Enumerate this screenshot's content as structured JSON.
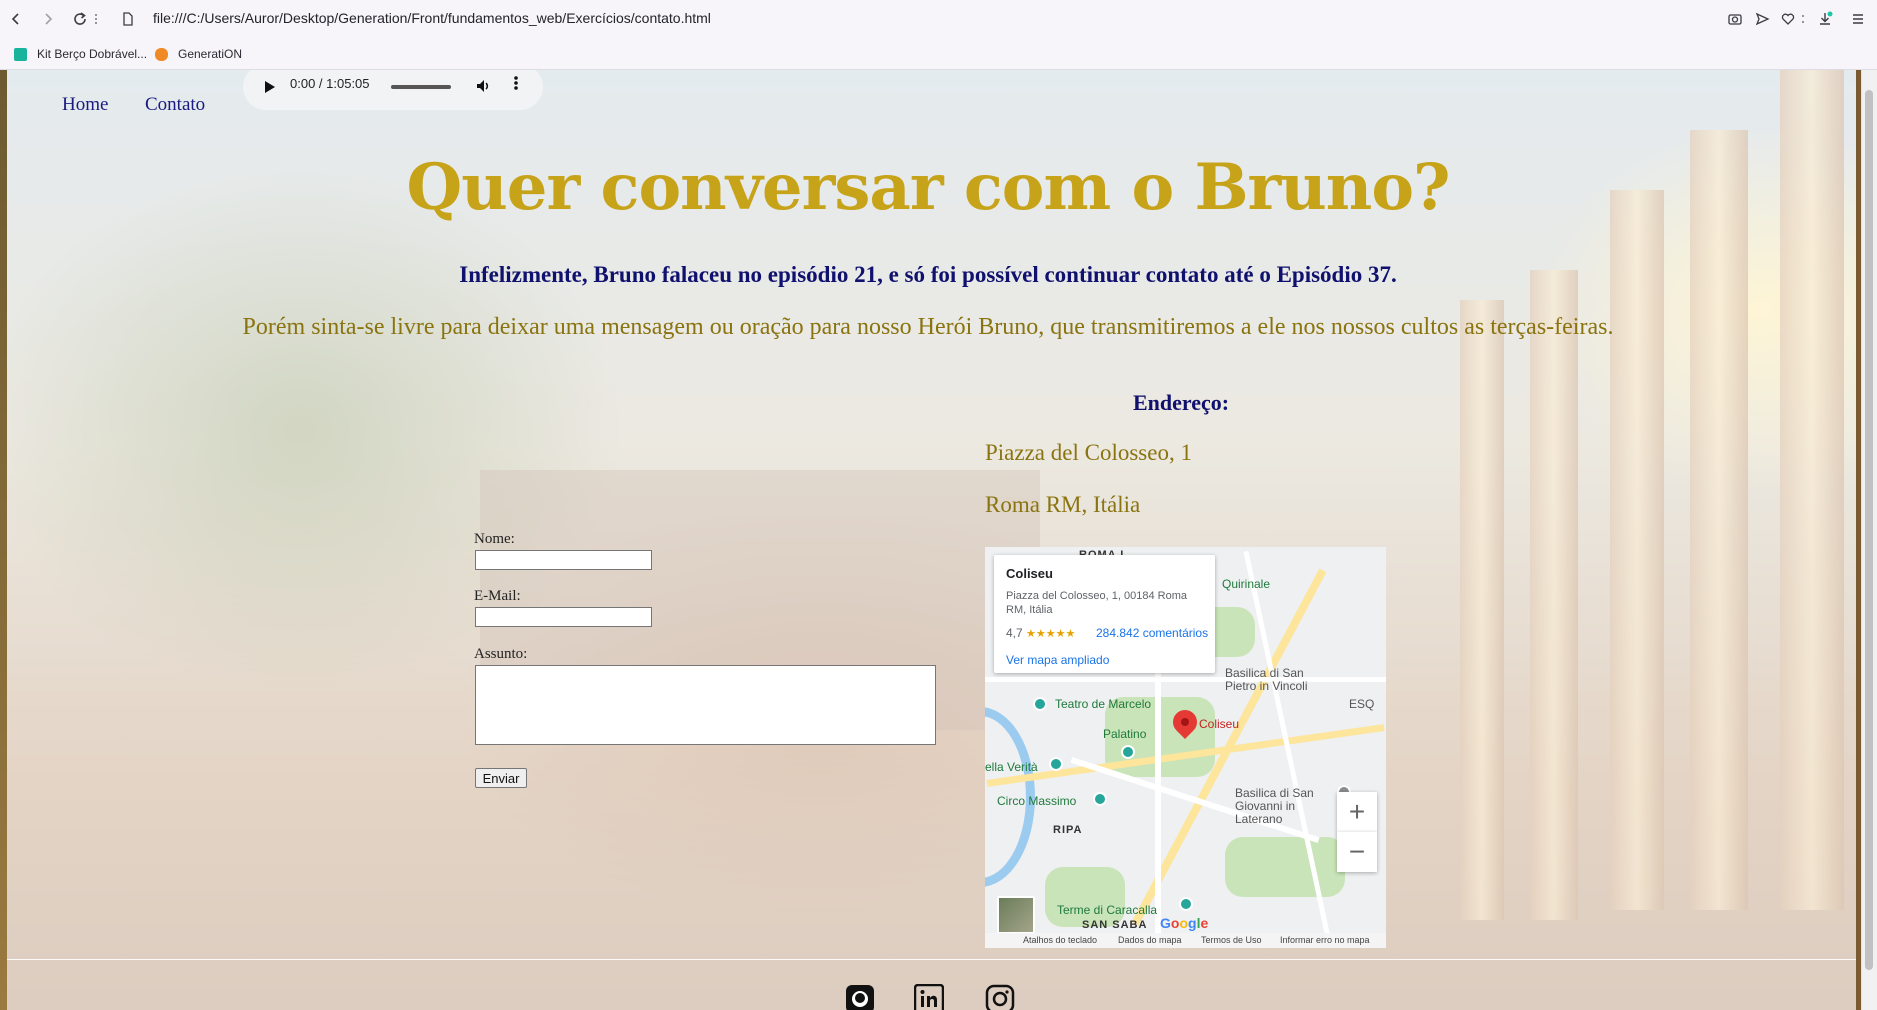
{
  "browser": {
    "url": "file:///C:/Users/Auror/Desktop/Generation/Front/fundamentos_web/Exercícios/contato.html",
    "bookmarks": [
      {
        "label": "Kit Berço Dobrável...",
        "color": "#18b39b"
      },
      {
        "label": "GeneratiON",
        "color": "#f08a24"
      }
    ]
  },
  "nav": {
    "home": "Home",
    "contact": "Contato"
  },
  "audio": {
    "time": "0:00 / 1:05:05"
  },
  "main": {
    "title": "Quer conversar com o Bruno?",
    "lead": "Infelizmente, Bruno falaceu no episódio 21, e só foi possível continuar contato até o Episódio 37.",
    "invite": "Porém sinta-se livre para deixar uma mensagem ou oração para nosso Herói Bruno, que transmitiremos a ele nos nossos cultos as terças-feiras."
  },
  "form": {
    "name_label": "Nome:",
    "email_label": "E-Mail:",
    "subject_label": "Assunto:",
    "submit_label": "Enviar"
  },
  "address": {
    "title": "Endereço:",
    "line1": "Piazza del Colosseo, 1",
    "line2": "Roma RM, Itália"
  },
  "map": {
    "card": {
      "title": "Coliseu",
      "address": "Piazza del Colosseo, 1, 00184 Roma RM, Itália",
      "rating": "4,7",
      "stars": "★★★★★",
      "reviews": "284.842 comentários",
      "link": "Ver mapa ampliado"
    },
    "labels": {
      "roma": "ROMA I",
      "quirinale": "Quirinale",
      "basilica_vincoli": "Basilica di San Pietro in Vincoli",
      "teatro": "Teatro de Marcelo",
      "palatino": "Palatino",
      "coliseu": "Coliseu",
      "verita": "ella Verità",
      "circo": "Circo Massimo",
      "basilica_laterano": "Basilica di San Giovanni in Laterano",
      "ripa": "RIPA",
      "terme": "Terme di Caracalla",
      "san_saba": "SAN SABA",
      "esq": "ESQ",
      "google": "Google"
    },
    "footer": {
      "shortcuts": "Atalhos do teclado",
      "data": "Dados do mapa",
      "terms": "Termos de Uso",
      "report": "Informar erro no mapa"
    },
    "zoom_in": "+",
    "zoom_out": "−"
  },
  "footer": {
    "social_icons": [
      "github-icon",
      "linkedin-icon",
      "instagram-icon"
    ]
  }
}
